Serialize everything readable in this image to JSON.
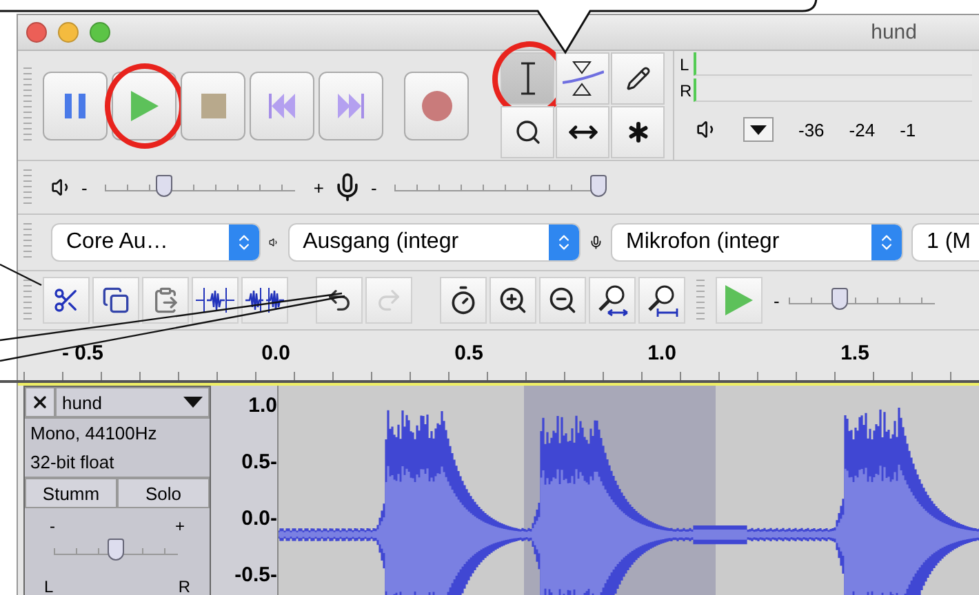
{
  "window": {
    "title": "hund"
  },
  "transport": [
    {
      "kind": "pause",
      "circled": false
    },
    {
      "kind": "play",
      "circled": true
    },
    {
      "kind": "stop",
      "circled": false
    },
    {
      "kind": "skip-start",
      "circled": false
    },
    {
      "kind": "skip-end",
      "circled": false
    },
    {
      "kind": "record",
      "circled": false
    }
  ],
  "tools": [
    {
      "kind": "select",
      "selected": true,
      "circled": true
    },
    {
      "kind": "envelope",
      "selected": false,
      "circled": false
    },
    {
      "kind": "draw",
      "selected": false,
      "circled": false
    },
    {
      "kind": "zoom",
      "selected": false,
      "circled": false
    },
    {
      "kind": "timeshift",
      "selected": false,
      "circled": false
    },
    {
      "kind": "multi",
      "selected": false,
      "circled": false
    }
  ],
  "meter": {
    "channels": [
      "L",
      "R"
    ],
    "ticks": [
      "-36",
      "-24",
      "-1"
    ]
  },
  "mixer": {
    "playback": {
      "min": "-",
      "max": "+",
      "level": 0.31
    },
    "recording": {
      "min": "-",
      "level": 0.98
    }
  },
  "devices": [
    {
      "kind": "host",
      "value": "Core Au…"
    },
    {
      "kind": "output",
      "value": "Ausgang (integr"
    },
    {
      "kind": "input",
      "value": "Mikrofon (integr"
    },
    {
      "kind": "channels",
      "value": "1 (M"
    }
  ],
  "edit_tools": [
    {
      "kind": "cut",
      "enabled": true
    },
    {
      "kind": "copy",
      "enabled": true
    },
    {
      "kind": "paste",
      "enabled": true
    },
    {
      "kind": "trim",
      "enabled": true
    },
    {
      "kind": "silence",
      "enabled": true
    },
    {
      "kind": "undo",
      "enabled": true
    },
    {
      "kind": "redo",
      "enabled": false
    },
    {
      "kind": "sync",
      "enabled": true
    },
    {
      "kind": "zoom-in",
      "enabled": true
    },
    {
      "kind": "zoom-out",
      "enabled": true
    },
    {
      "kind": "fit-selection",
      "enabled": true
    },
    {
      "kind": "fit-project",
      "enabled": true
    }
  ],
  "play_at_speed": {
    "min": "-",
    "level": 0.35
  },
  "ruler": {
    "labels": [
      "- 0.5",
      "0.0",
      "0.5",
      "1.0",
      "1.5"
    ]
  },
  "track": {
    "name": "hund",
    "info": [
      "Mono, 44100Hz",
      "32-bit float"
    ],
    "buttons": [
      {
        "label": "Stumm",
        "on": false
      },
      {
        "label": "Solo",
        "on": false
      }
    ],
    "gain": {
      "min": "-",
      "max": "+",
      "level": 0.5
    },
    "pan": {
      "left": "L",
      "right": "R"
    },
    "scale": [
      "1.0",
      "0.5-",
      "0.0-",
      "-0.5-"
    ]
  }
}
